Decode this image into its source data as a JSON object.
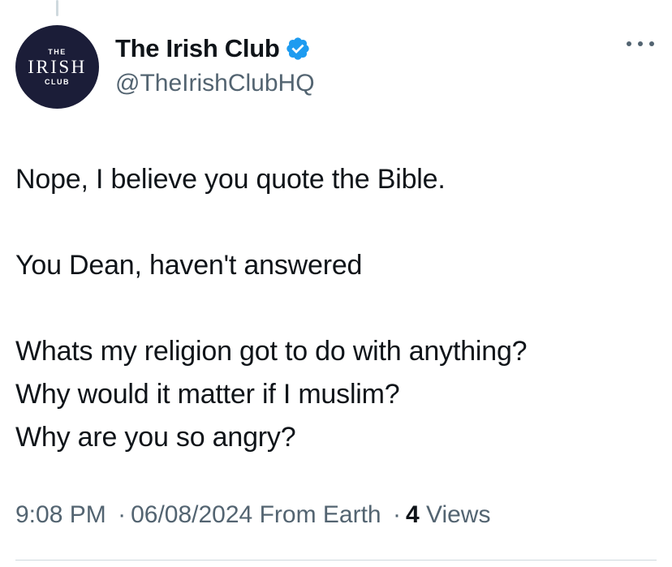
{
  "avatar": {
    "text_top": "THE",
    "text_main": "IRISH",
    "text_bottom": "CLUB",
    "background": "#1b1d38"
  },
  "author": {
    "display_name": "The Irish Club",
    "handle": "@TheIrishClubHQ",
    "verified_icon": "verified-badge-icon",
    "verified_color": "#1d9bf0"
  },
  "more_menu_icon": "more-horizontal-icon",
  "tweet": {
    "line1": "Nope, I believe you quote the Bible.",
    "line2": "You Dean, haven't answered",
    "line3": "Whats my religion got to do with anything?",
    "line4": "Why would it matter if I muslim?",
    "line5": "Why are you so angry?"
  },
  "meta": {
    "time": "9:08 PM",
    "separator": "·",
    "date": "06/08/2024",
    "source": "From Earth",
    "views_count": "4",
    "views_label": "Views"
  }
}
